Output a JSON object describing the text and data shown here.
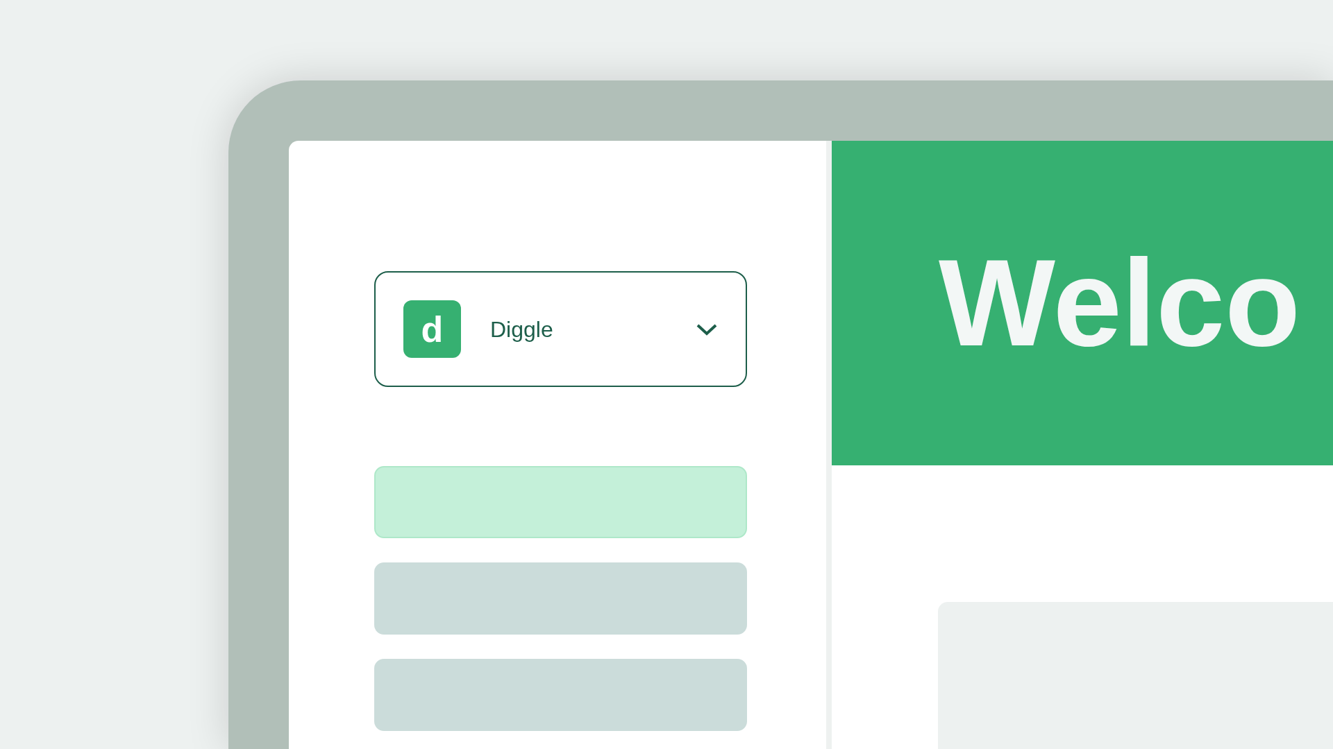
{
  "app_switcher": {
    "logo_letter": "d",
    "name": "Diggle",
    "expanded": false
  },
  "nav_items": [
    {
      "selected": true
    },
    {
      "selected": false
    },
    {
      "selected": false
    }
  ],
  "header": {
    "title": "Welco"
  }
}
